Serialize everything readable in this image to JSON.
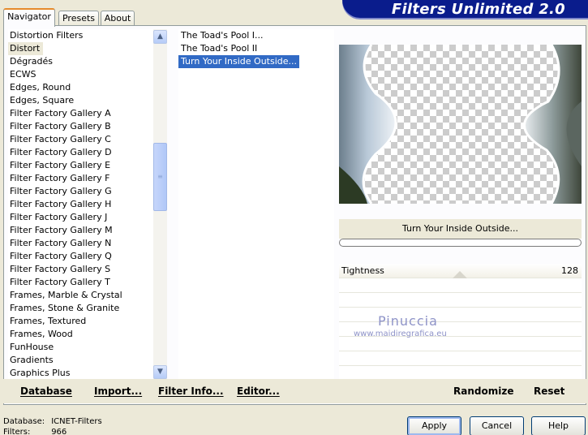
{
  "tabs": [
    "Navigator",
    "Presets",
    "About"
  ],
  "banner_title": "Filters Unlimited 2.0",
  "categories": [
    "Distortion Filters",
    "Distort",
    "Dégradés",
    "ECWS",
    "Edges, Round",
    "Edges, Square",
    "Filter Factory Gallery A",
    "Filter Factory Gallery B",
    "Filter Factory Gallery C",
    "Filter Factory Gallery D",
    "Filter Factory Gallery E",
    "Filter Factory Gallery F",
    "Filter Factory Gallery G",
    "Filter Factory Gallery H",
    "Filter Factory Gallery J",
    "Filter Factory Gallery M",
    "Filter Factory Gallery N",
    "Filter Factory Gallery Q",
    "Filter Factory Gallery S",
    "Filter Factory Gallery T",
    "Frames, Marble & Crystal",
    "Frames, Stone & Granite",
    "Frames, Textured",
    "Frames, Wood",
    "FunHouse",
    "Gradients",
    "Graphics Plus"
  ],
  "selected_category": "Distort",
  "filters": [
    "The Toad's Pool I...",
    "The Toad's Pool II",
    "Turn Your Inside Outside..."
  ],
  "selected_filter": "Turn Your Inside Outside...",
  "filter_name": "Turn Your Inside Outside...",
  "slider": {
    "label": "Tightness",
    "value": "128"
  },
  "watermark": {
    "name": "Pinuccia",
    "url": "www.maidiregrafica.eu"
  },
  "toolbar": {
    "database": "Database",
    "import": "Import...",
    "filter_info": "Filter Info...",
    "editor": "Editor...",
    "randomize": "Randomize",
    "reset": "Reset"
  },
  "footer": {
    "database_label": "Database:",
    "database_value": "ICNET-Filters",
    "filters_label": "Filters:",
    "filters_value": "966"
  },
  "buttons": {
    "apply": "Apply",
    "cancel": "Cancel",
    "help": "Help"
  },
  "icons": {
    "scroll_up": "arrow-up-icon",
    "scroll_down": "arrow-down-icon",
    "thumb": "grip-icon"
  }
}
